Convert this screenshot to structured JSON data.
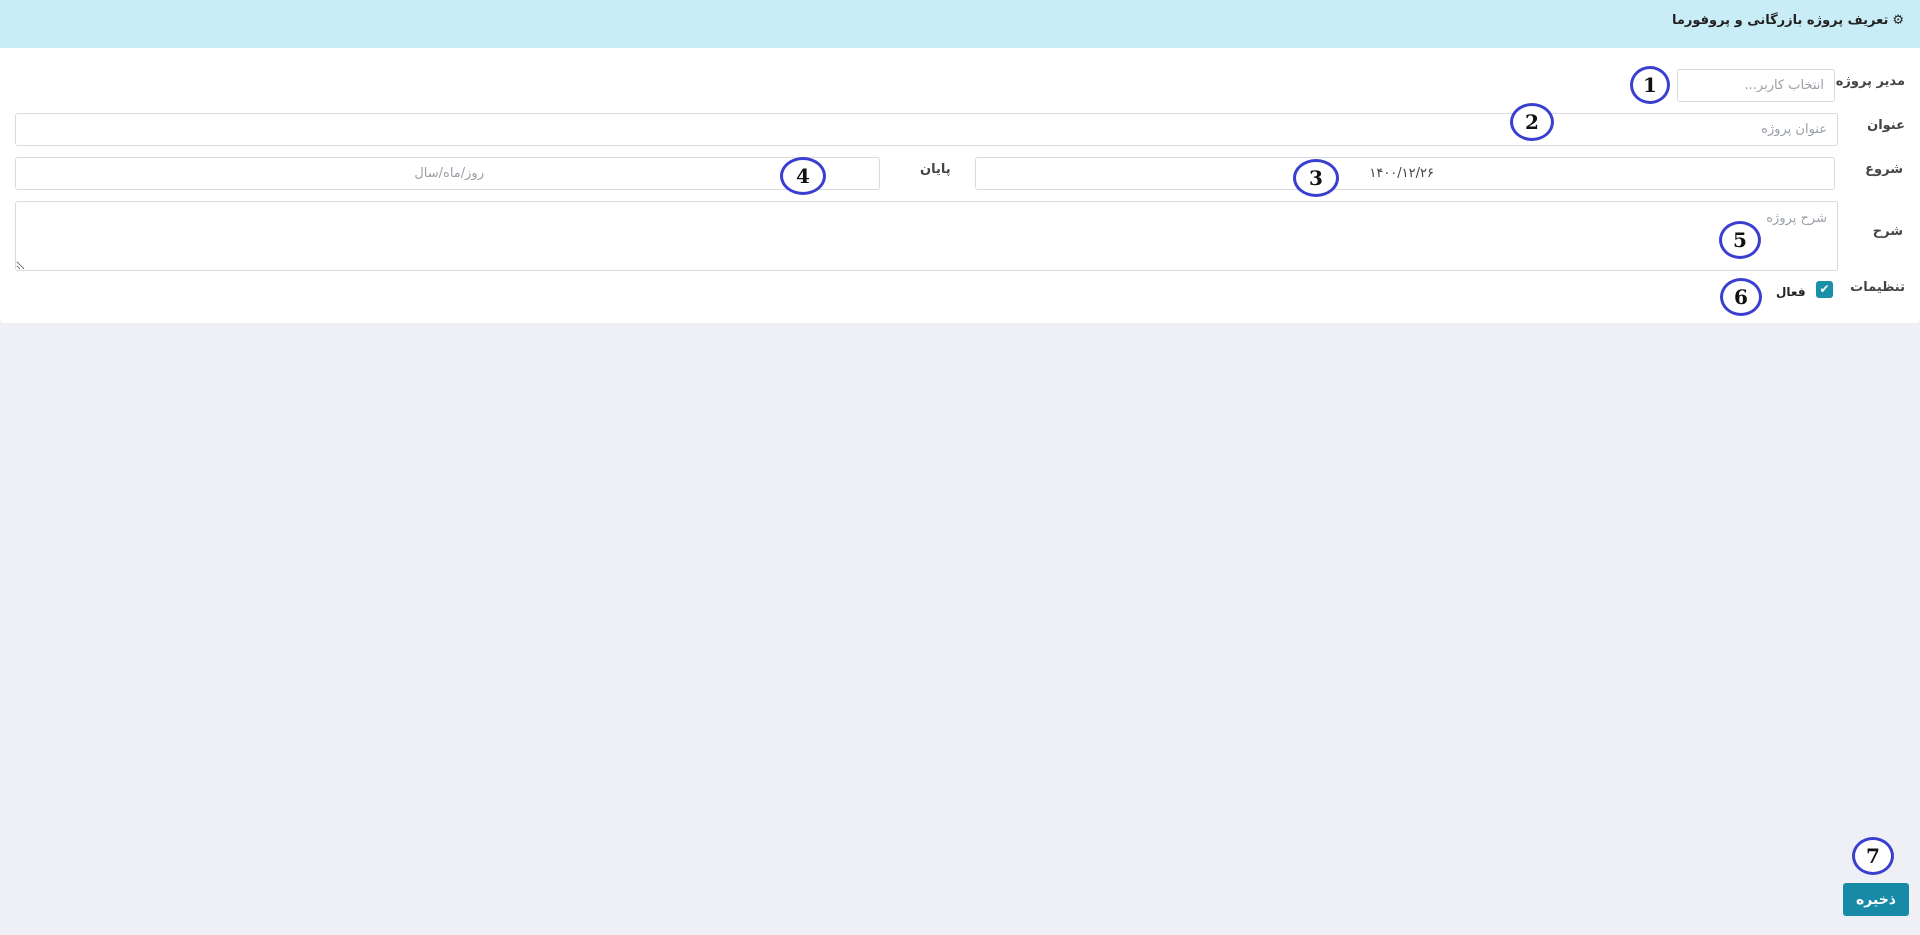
{
  "header": {
    "gear_icon": "⚙",
    "title": "تعریف پروژه بازرگانی و پروفورما"
  },
  "form": {
    "manager_label": "مدیر پروژه",
    "manager_placeholder": "انتخاب کاربر...",
    "title_label": "عنوان",
    "title_placeholder": "عنوان پروژه",
    "start_label": "شروع",
    "start_value": "۱۴۰۰/۱۲/۲۶",
    "end_label": "پایان",
    "end_placeholder": "روز/ماه/سال",
    "description_label": "شرح",
    "description_placeholder": "شرح پروژه",
    "settings_label": "تنظیمات",
    "active_label": "فعال",
    "active_checked": true
  },
  "actions": {
    "save_label": "ذخیره"
  },
  "annotations": [
    "1",
    "2",
    "3",
    "4",
    "5",
    "6",
    "7"
  ],
  "colors": {
    "header_bg": "#c9edf6",
    "accent": "#168aa6",
    "annotation_ring": "#3a3fd0",
    "page_bg": "#eff0f5"
  }
}
